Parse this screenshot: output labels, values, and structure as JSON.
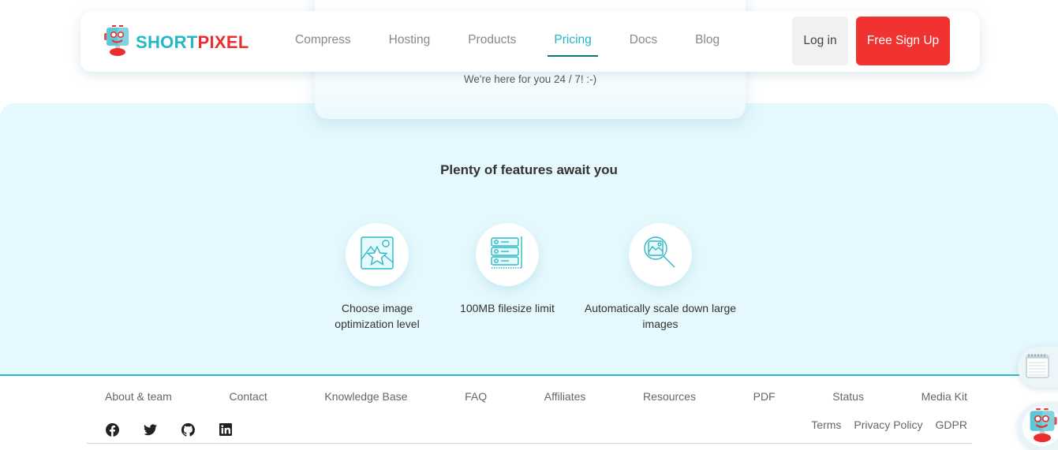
{
  "brand": {
    "name_part1": "SHORT",
    "name_part2": "PIXEL",
    "colors": {
      "teal": "#22b8c8",
      "red": "#ea2e2e",
      "accent_bg": "#e4f8fd",
      "underline": "#136f79"
    }
  },
  "nav": {
    "links": [
      {
        "label": "Compress",
        "active": false
      },
      {
        "label": "Hosting",
        "active": false
      },
      {
        "label": "Products",
        "active": false
      },
      {
        "label": "Pricing",
        "active": true
      },
      {
        "label": "Docs",
        "active": false
      },
      {
        "label": "Blog",
        "active": false
      }
    ],
    "login_label": "Log in",
    "signup_label": "Free Sign Up"
  },
  "support": {
    "text": "We're here for you 24 / 7! :-)"
  },
  "features": {
    "title": "Plenty of features await you",
    "items": [
      {
        "icon": "image-star-icon",
        "label": "Choose image optimization level"
      },
      {
        "icon": "server-stack-icon",
        "label": "100MB filesize limit"
      },
      {
        "icon": "image-magnify-icon",
        "label": "Automatically scale down large images"
      }
    ]
  },
  "footer": {
    "links": [
      "About & team",
      "Contact",
      "Knowledge Base",
      "FAQ",
      "Affiliates",
      "Resources",
      "PDF",
      "Status",
      "Media Kit"
    ],
    "social": [
      "facebook-icon",
      "twitter-icon",
      "github-icon",
      "linkedin-icon"
    ],
    "legal": [
      "Terms",
      "Privacy Policy",
      "GDPR"
    ]
  },
  "floating": {
    "notes_icon": "notepad-icon",
    "chat_icon": "robot-chat-icon"
  }
}
